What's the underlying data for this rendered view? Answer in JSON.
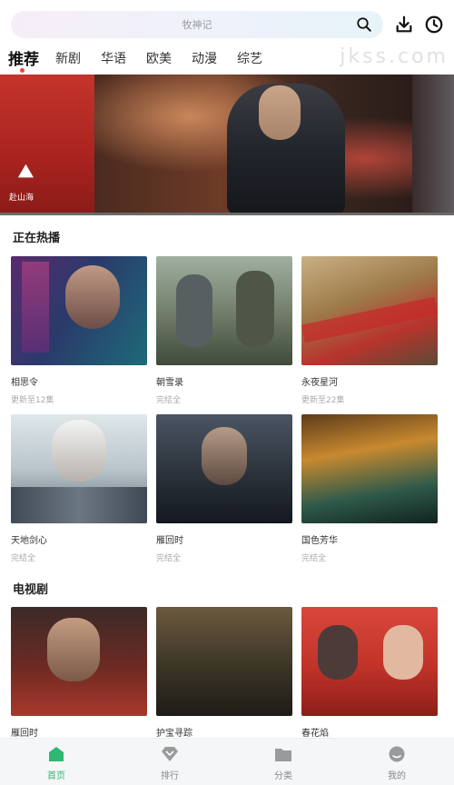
{
  "header": {
    "search_placeholder": "牧神记"
  },
  "tabs": [
    {
      "label": "推荐",
      "active": true
    },
    {
      "label": "新剧"
    },
    {
      "label": "华语"
    },
    {
      "label": "欧美"
    },
    {
      "label": "动漫"
    },
    {
      "label": "综艺"
    }
  ],
  "watermark": "jkss.com",
  "banner": {
    "logo_text": "赴山海",
    "caption": "赴山海"
  },
  "sections": [
    {
      "title": "正在热播",
      "items": [
        {
          "title": "相思令",
          "sub": "更新至12集"
        },
        {
          "title": "朝雪录",
          "sub": "完结全"
        },
        {
          "title": "永夜星河",
          "sub": "更新至22集"
        },
        {
          "title": "天地剑心",
          "sub": "完结全"
        },
        {
          "title": "雁回时",
          "sub": "完结全"
        },
        {
          "title": "国色芳华",
          "sub": "完结全"
        }
      ]
    },
    {
      "title": "电视剧",
      "items": [
        {
          "title": "雁回时",
          "sub": ""
        },
        {
          "title": "护宝寻踪",
          "sub": ""
        },
        {
          "title": "春花焰",
          "sub": ""
        }
      ]
    }
  ],
  "nav": [
    {
      "label": "首页",
      "active": true
    },
    {
      "label": "排行"
    },
    {
      "label": "分类"
    },
    {
      "label": "我的"
    }
  ],
  "colors": {
    "accent": "#2eb872",
    "tab_dot": "#ef4444"
  }
}
